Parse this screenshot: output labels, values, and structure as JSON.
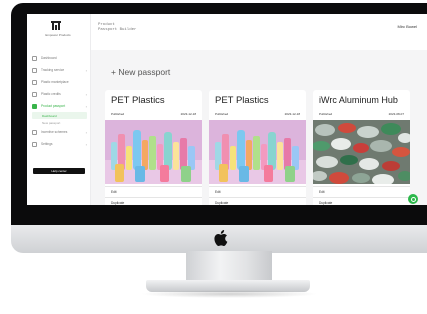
{
  "sidebar": {
    "logo_text": "Empower Products",
    "items": [
      {
        "label": "Dashboard",
        "icon": "grid-icon",
        "chevron": false
      },
      {
        "label": "Tracking service",
        "icon": "truck-icon",
        "chevron": true
      },
      {
        "label": "Plastic marketplace",
        "icon": "cart-icon",
        "chevron": false
      },
      {
        "label": "Plastic credits",
        "icon": "leaf-icon",
        "chevron": true
      },
      {
        "label": "Product passport",
        "icon": "passport-icon",
        "chevron": true,
        "active": true
      }
    ],
    "sub_items": [
      {
        "label": "Dashboard",
        "active": true
      },
      {
        "label": "New passport",
        "active": false
      }
    ],
    "bottom_items": [
      {
        "label": "Incentive schemes",
        "icon": "gift-icon",
        "chevron": true
      },
      {
        "label": "Settings",
        "icon": "gear-icon",
        "chevron": true
      }
    ],
    "help_label": "Help center"
  },
  "header": {
    "title_line1": "Product",
    "title_line2": "Passport Builder",
    "user_name": "Mirc Bowel"
  },
  "main": {
    "new_passport_label": "+ New passport"
  },
  "cards": [
    {
      "title": "PET Plastics",
      "status": "Published",
      "date": "2023-12-18",
      "image": "pet-bottles-image",
      "actions": [
        "Edit",
        "Duplicate"
      ]
    },
    {
      "title": "PET Plastics",
      "status": "Published",
      "date": "2023-12-18",
      "image": "pet-bottles-image",
      "actions": [
        "Edit",
        "Duplicate"
      ]
    },
    {
      "title": "iWrc Aluminum Hub",
      "status": "Published",
      "date": "2023-08-07",
      "image": "aluminum-cans-image",
      "actions": [
        "Edit",
        "Duplicate"
      ]
    }
  ],
  "colors": {
    "accent": "#38b44a",
    "background": "#f5f5f6"
  }
}
